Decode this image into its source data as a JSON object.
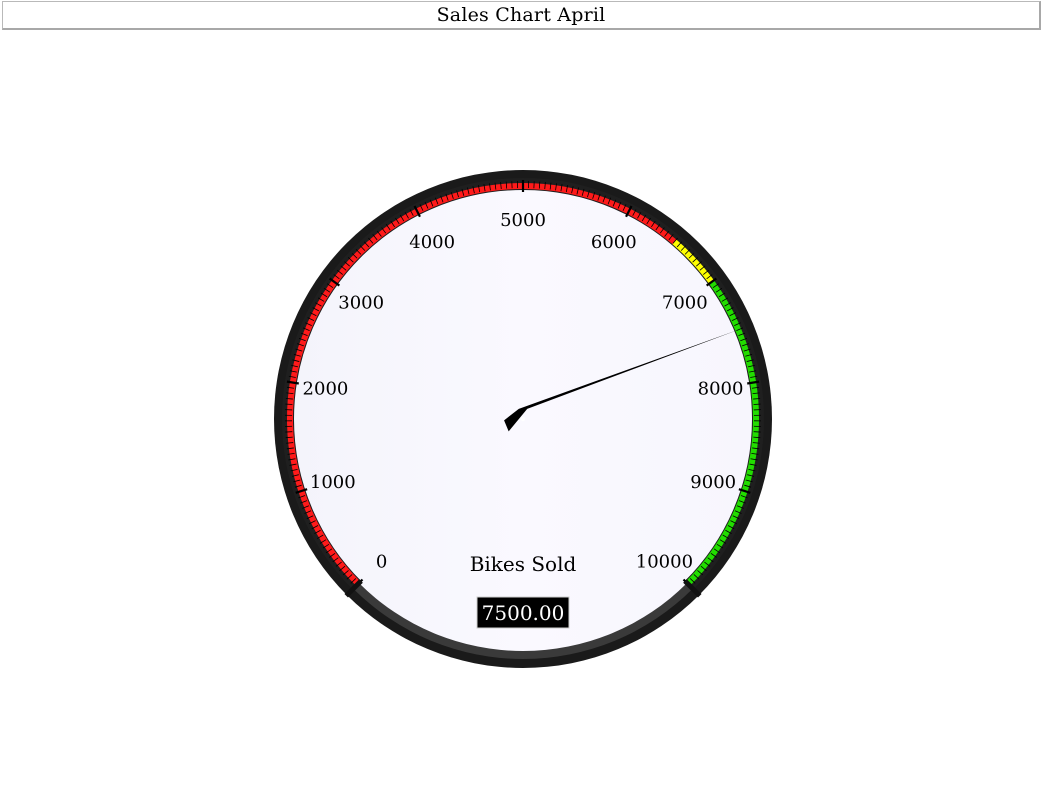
{
  "title": "Sales Chart April",
  "chart_data": {
    "type": "gauge",
    "title": "Sales Chart April",
    "label": "Bikes Sold",
    "value": 7500,
    "value_display": "7500.00",
    "min": 0,
    "max": 10000,
    "major_ticks": [
      0,
      1000,
      2000,
      3000,
      4000,
      5000,
      6000,
      7000,
      8000,
      9000,
      10000
    ],
    "major_tick_labels": [
      "0",
      "1000",
      "2000",
      "3000",
      "4000",
      "5000",
      "6000",
      "7000",
      "8000",
      "9000",
      "10000"
    ],
    "minor_ticks_per_major": 20,
    "bands": [
      {
        "from": 0,
        "to": 6500,
        "color": "#ff1a1a"
      },
      {
        "from": 6500,
        "to": 7000,
        "color": "#ffff00"
      },
      {
        "from": 7000,
        "to": 10000,
        "color": "#22dd00"
      }
    ],
    "colors": {
      "face": "#f9f8ff",
      "rim": "#1a1a1a",
      "needle": "#000000",
      "value_box": "#000000",
      "value_text": "#ffffff"
    }
  }
}
